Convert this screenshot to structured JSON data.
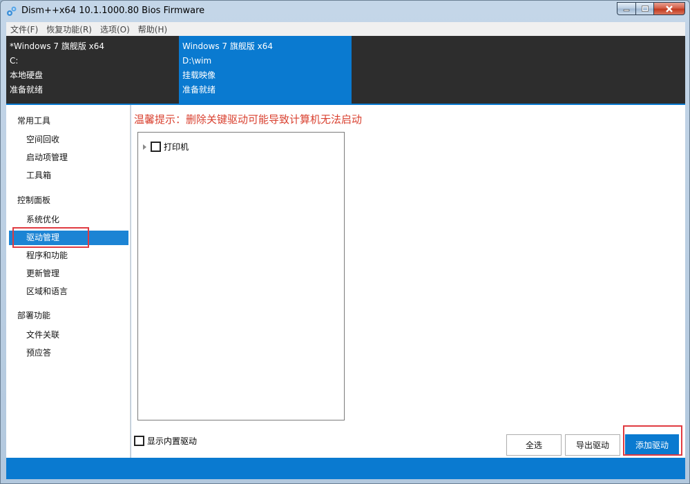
{
  "window": {
    "title": "Dism++x64 10.1.1000.80 Bios Firmware"
  },
  "menubar": {
    "items": [
      "文件(F)",
      "恢复功能(R)",
      "选项(O)",
      "帮助(H)"
    ]
  },
  "images": [
    {
      "name": "*Windows 7 旗舰版 x64",
      "path": "C:",
      "type": "本地硬盘",
      "status": "准备就绪"
    },
    {
      "name": "Windows 7 旗舰版 x64",
      "path": "D:\\wim",
      "type": "挂载映像",
      "status": "准备就绪"
    }
  ],
  "sidebar": {
    "groups": [
      {
        "label": "常用工具",
        "items": [
          "空间回收",
          "启动项管理",
          "工具箱"
        ]
      },
      {
        "label": "控制面板",
        "items": [
          "系统优化",
          "驱动管理",
          "程序和功能",
          "更新管理",
          "区域和语言"
        ]
      },
      {
        "label": "部署功能",
        "items": [
          "文件关联",
          "预应答"
        ]
      }
    ],
    "active_item": "驱动管理"
  },
  "content": {
    "warning": "温馨提示：删除关键驱动可能导致计算机无法启动",
    "tree_items": [
      {
        "label": "打印机",
        "checked": false
      }
    ],
    "show_builtin_label": "显示内置驱动",
    "buttons": {
      "select_all": "全选",
      "export": "导出驱动",
      "add": "添加驱动"
    }
  },
  "colors": {
    "accent": "#0a7ad0",
    "warning": "#d9402f",
    "highlight_box": "#e03a40",
    "dark_bar": "#2d2d2d"
  }
}
